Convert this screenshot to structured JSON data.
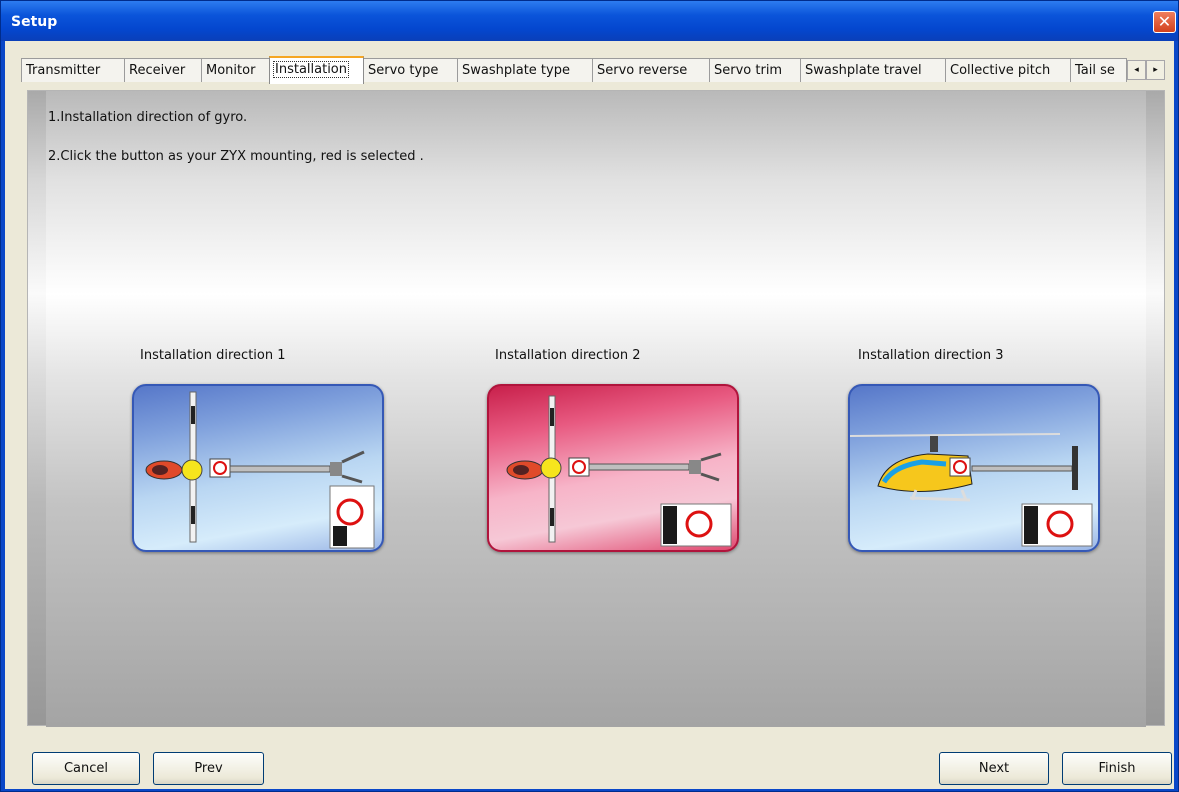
{
  "window": {
    "title": "Setup",
    "close_icon": "close-icon"
  },
  "tabs": [
    "Transmitter",
    "Receiver",
    "Monitor",
    "Installation",
    "Servo type",
    "Swashplate type",
    "Servo reverse",
    "Servo trim",
    "Swashplate travel",
    "Collective pitch",
    "Tail se"
  ],
  "active_tab": "Installation",
  "tab_scroll": {
    "left": "◂",
    "right": "▸"
  },
  "instructions": {
    "line1": "1.Installation direction of gyro.",
    "line2": "2.Click the button as your ZYX mounting, red is selected ."
  },
  "directions": [
    {
      "label": "Installation direction 1",
      "selected": false
    },
    {
      "label": "Installation direction  2",
      "selected": true
    },
    {
      "label": "Installation direction 3",
      "selected": false
    }
  ],
  "buttons": {
    "cancel": "Cancel",
    "prev": "Prev",
    "next": "Next",
    "finish": "Finish"
  },
  "colors": {
    "titlebar": "#0b55da",
    "selected": "#e85a81",
    "unselected": "#7fa0dc"
  }
}
